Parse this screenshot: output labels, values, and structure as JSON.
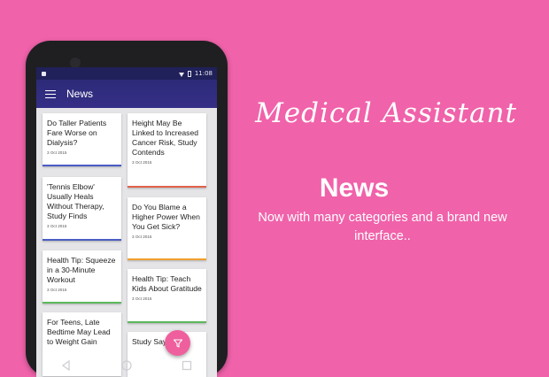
{
  "status_bar": {
    "time": "11:08"
  },
  "app_bar": {
    "title": "News"
  },
  "articles": [
    {
      "title": "Do Taller Patients Fare Worse on Dialysis?",
      "date": "3 Oct 2015",
      "accent": "#4a5cc4"
    },
    {
      "title": "Height May Be Linked to Increased Cancer Risk, Study Contends",
      "date": "3 Oct 2015",
      "accent": "#e2624a"
    },
    {
      "title": "'Tennis Elbow' Usually Heals Without Therapy, Study Finds",
      "date": "3 Oct 2015",
      "accent": "#4a5cc4"
    },
    {
      "title": "Do You Blame a Higher Power When You Get Sick?",
      "date": "3 Oct 2015",
      "accent": "#f0a030"
    },
    {
      "title": "Health Tip: Squeeze in a 30-Minute Workout",
      "date": "3 Oct 2015",
      "accent": "#5cb85c"
    },
    {
      "title": "Health Tip: Teach Kids About Gratitude",
      "date": "3 Oct 2015",
      "accent": "#5cb85c"
    },
    {
      "title": "For Teens, Late Bedtime May Lead to Weight Gain",
      "date": "",
      "accent": "#4a5cc4"
    },
    {
      "title": "Study Says",
      "date": "",
      "accent": "#4a5cc4"
    }
  ],
  "promo": {
    "app_name": "Medical Assistant",
    "feature": "News",
    "description": "Now with many categories and a brand new interface.."
  },
  "icons": {
    "menu": "hamburger-menu-icon",
    "fab": "filter-icon",
    "nav": [
      "back-icon",
      "home-icon",
      "recents-icon"
    ]
  },
  "colors": {
    "background": "#f062aa",
    "app_bar": "#302c7c",
    "fab": "#ef5f9d"
  }
}
